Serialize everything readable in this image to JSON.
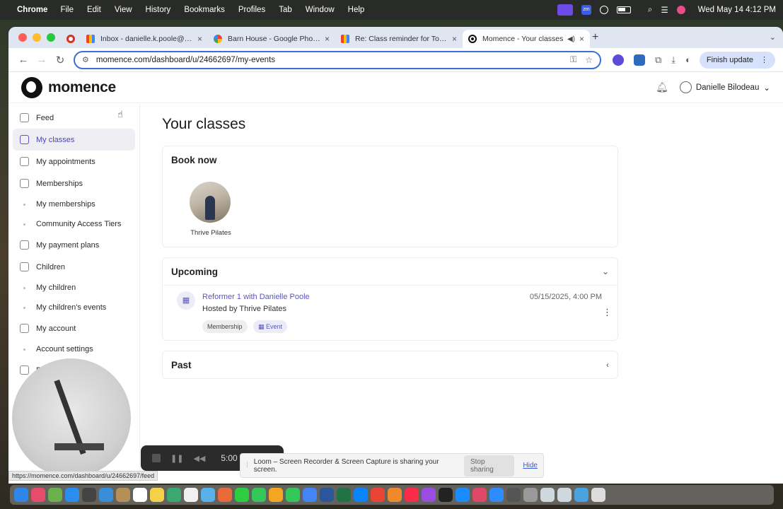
{
  "menubar": {
    "app": "Chrome",
    "items": [
      "File",
      "Edit",
      "View",
      "History",
      "Bookmarks",
      "Profiles",
      "Tab",
      "Window",
      "Help"
    ],
    "clock": "Wed May 14  4:12 PM"
  },
  "browser": {
    "tabs": [
      {
        "label": "Inbox - danielle.k.poole@gmail",
        "icon": "gmail-icon"
      },
      {
        "label": "Barn House - Google Photos",
        "icon": "photos-icon"
      },
      {
        "label": "Re: Class reminder for Tower",
        "icon": "gmail-icon"
      },
      {
        "label": "Momence - Your classes",
        "icon": "momence-icon"
      }
    ],
    "url": "momence.com/dashboard/u/24662697/my-events",
    "finish_update": "Finish update",
    "extension_badges": [
      "2",
      "2"
    ]
  },
  "app": {
    "logo": "momence",
    "user_name": "Danielle Bilodeau"
  },
  "sidebar": {
    "items": [
      {
        "label": "Feed"
      },
      {
        "label": "My classes"
      },
      {
        "label": "My appointments"
      },
      {
        "label": "Memberships"
      },
      {
        "label": "My memberships"
      },
      {
        "label": "Community Access Tiers"
      },
      {
        "label": "My payment plans"
      },
      {
        "label": "Children"
      },
      {
        "label": "My children"
      },
      {
        "label": "My children's events"
      },
      {
        "label": "My account"
      },
      {
        "label": "Account settings"
      },
      {
        "label": "P"
      }
    ]
  },
  "main": {
    "title": "Your classes",
    "book_now": {
      "heading": "Book now",
      "studio": "Thrive Pilates"
    },
    "upcoming": {
      "heading": "Upcoming",
      "event": {
        "title": "Reformer 1 with Danielle Poole",
        "host": "Hosted by Thrive Pilates",
        "datetime": "05/15/2025, 4:00 PM",
        "tags": [
          "Membership",
          "Event"
        ]
      }
    },
    "past": {
      "heading": "Past"
    }
  },
  "overlays": {
    "status_url": "https://momence.com/dashboard/u/24662697/feed",
    "recorder_time": "5:00",
    "share_message": "Loom – Screen Recorder & Screen Capture is sharing your screen.",
    "stop_sharing": "Stop sharing",
    "hide": "Hide"
  },
  "colors": {
    "accent": "#5b54c6",
    "omnibox_border": "#3c6fd6",
    "finish_update_bg": "#d6e2fb"
  }
}
